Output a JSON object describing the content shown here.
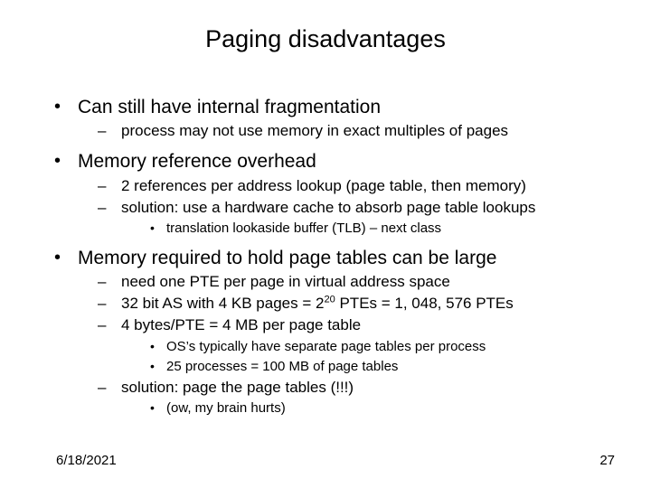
{
  "title": "Paging disadvantages",
  "bullets": {
    "b1": "Can still have internal fragmentation",
    "b1a": "process may not use memory in exact multiples of pages",
    "b2": "Memory reference overhead",
    "b2a": "2 references per address lookup (page table, then memory)",
    "b2b": "solution: use a hardware cache to absorb page table lookups",
    "b2b1": "translation lookaside buffer (TLB) – next class",
    "b3": "Memory required to hold page tables can be large",
    "b3a": "need one PTE per page in virtual address space",
    "b3b_pre": "32 bit AS with 4 KB pages = 2",
    "b3b_exp": "20",
    "b3b_post": " PTEs = 1, 048, 576 PTEs",
    "b3c": "4 bytes/PTE = 4 MB per page table",
    "b3c1": "OS’s typically have separate page tables per process",
    "b3c2": "25 processes = 100 MB of page tables",
    "b3d": "solution: page the page tables (!!!)",
    "b3d1": "(ow, my brain hurts)"
  },
  "footer": {
    "date": "6/18/2021",
    "page": "27"
  }
}
